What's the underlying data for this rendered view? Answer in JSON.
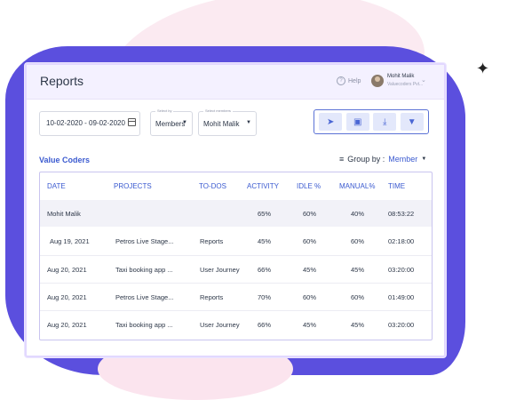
{
  "header": {
    "title": "Reports",
    "help_label": "Help",
    "user_name": "Mohit Malik",
    "user_subtitle": "Valuecoders Pvt..."
  },
  "filters": {
    "date_range": "10-02-2020 - 09-02-2020",
    "select_by_label": "Select by",
    "select_by_value": "Members",
    "select_members_label": "Select members",
    "select_members_value": "Mohit Malik"
  },
  "toolbar": {
    "icons": [
      "send-icon",
      "calendar-icon",
      "download-icon",
      "filter-icon"
    ]
  },
  "section": {
    "title": "Value Coders",
    "group_by_label": "Group by :",
    "group_by_value": "Member"
  },
  "table": {
    "columns": [
      "DATE",
      "PROJECTS",
      "TO-DOS",
      "ACTIVITY",
      "IDLE %",
      "MANUAL%",
      "TIME"
    ],
    "member_row": {
      "name": "Mohit Malik",
      "activity": "65%",
      "idle": "60%",
      "manual": "40%",
      "time": "08:53:22"
    },
    "rows": [
      {
        "date": "Aug 19, 2021",
        "project": "Petros Live Stage...",
        "todo": "Reports",
        "activity": "45%",
        "idle": "60%",
        "manual": "60%",
        "time": "02:18:00"
      },
      {
        "date": "Aug 20, 2021",
        "project": "Taxi booking app ...",
        "todo": "User Journey",
        "activity": "66%",
        "idle": "45%",
        "manual": "45%",
        "time": "03:20:00"
      },
      {
        "date": "Aug 20, 2021",
        "project": "Petros Live Stage...",
        "todo": "Reports",
        "activity": "70%",
        "idle": "60%",
        "manual": "60%",
        "time": "01:49:00"
      },
      {
        "date": "Aug 20, 2021",
        "project": "Taxi booking app ...",
        "todo": "User Journey",
        "activity": "66%",
        "idle": "45%",
        "manual": "45%",
        "time": "03:20:00"
      }
    ]
  },
  "colors": {
    "accent": "#3c5bd0",
    "background_blob": "#5b4fde",
    "header_bg": "#f4f1ff"
  }
}
